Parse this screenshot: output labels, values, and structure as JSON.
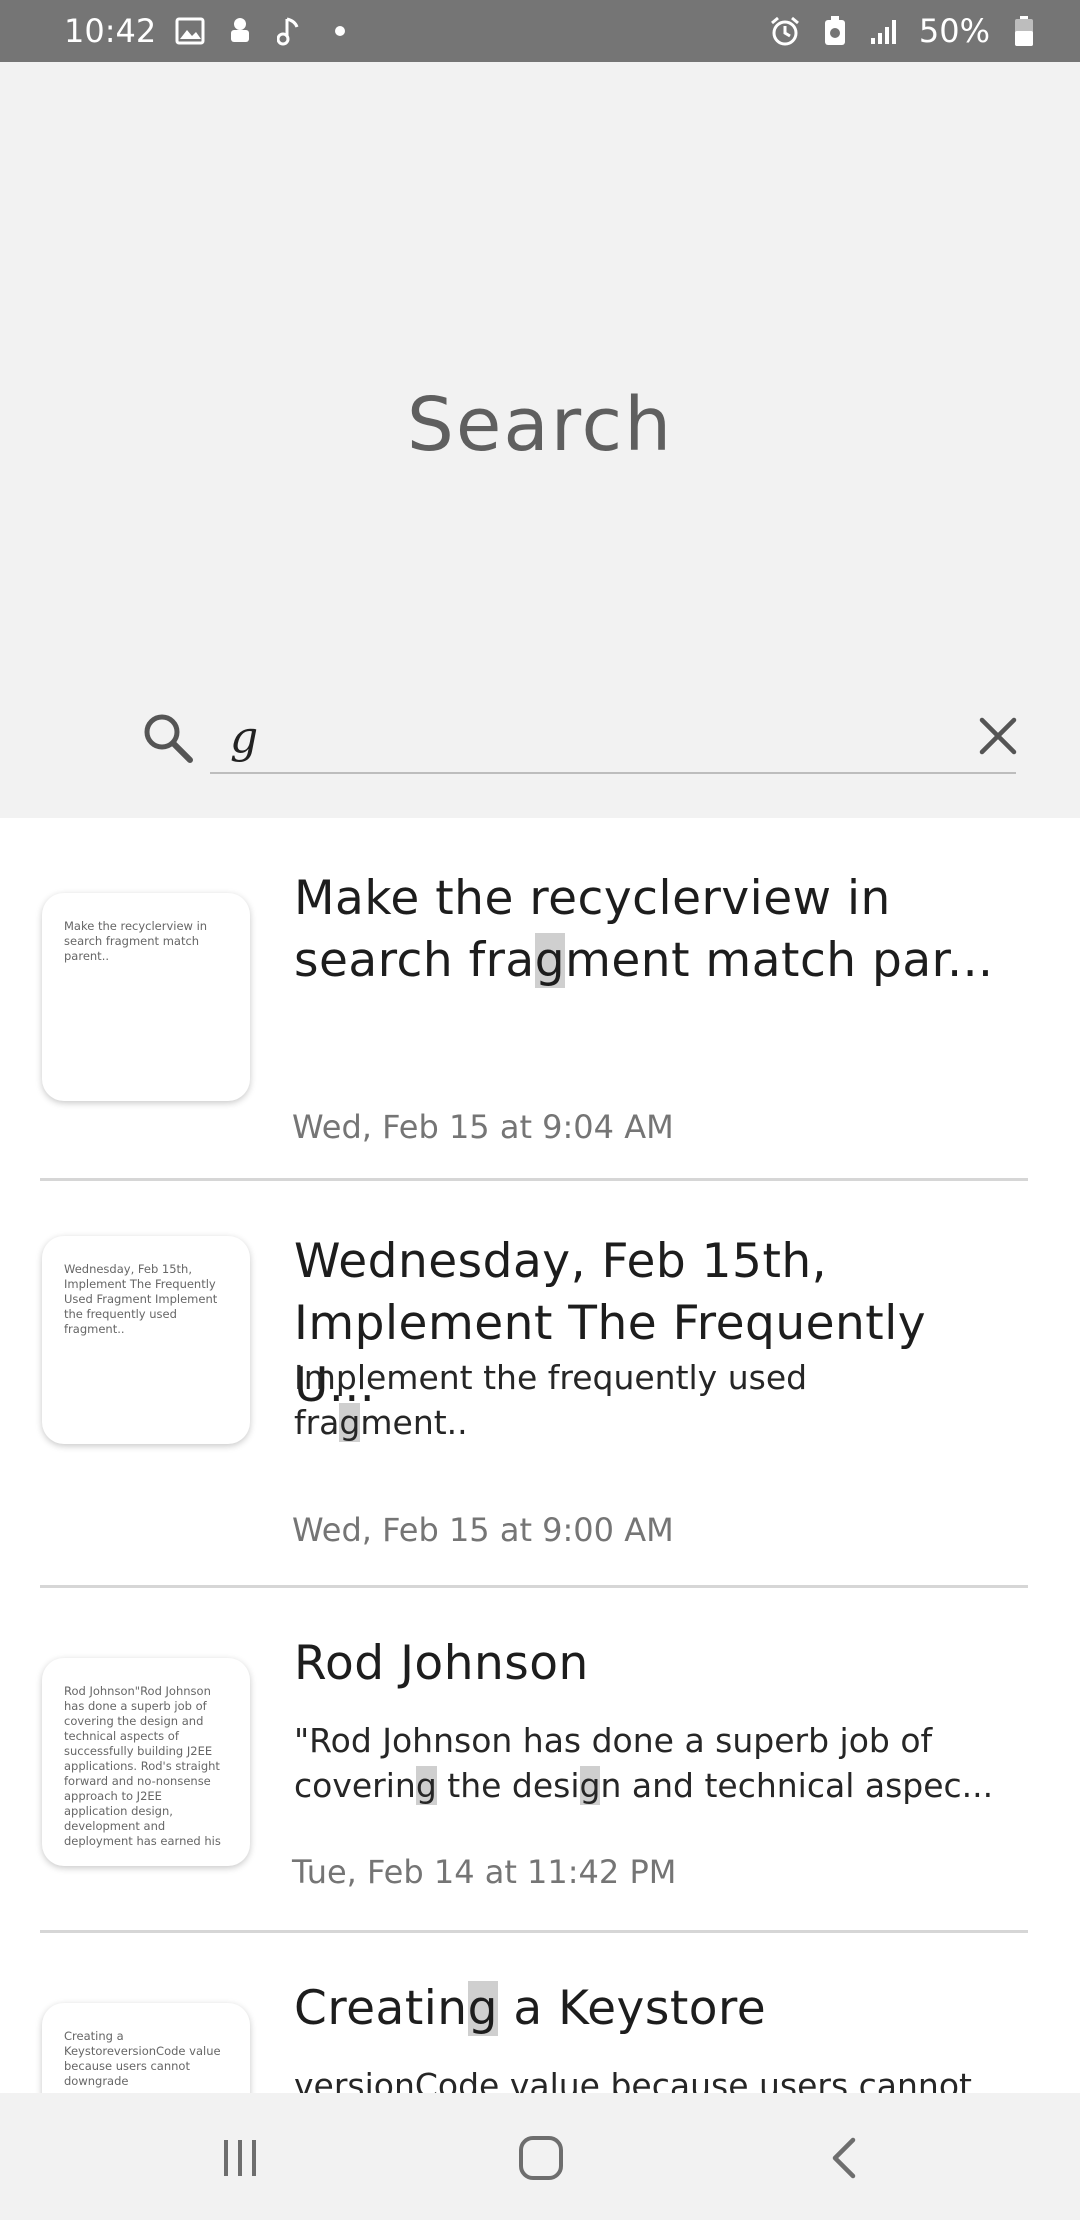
{
  "status_bar": {
    "time": "10:42",
    "battery": "50%",
    "left_icons": [
      "image-icon",
      "android-icon",
      "music-note-icon",
      "dot-icon"
    ],
    "right_icons": [
      "alarm-icon",
      "battery-saver-icon",
      "signal-icon",
      "battery-icon"
    ]
  },
  "header": {
    "title": "Search"
  },
  "search": {
    "query": "g",
    "icon": "search-icon",
    "clear_icon": "close-icon"
  },
  "results": [
    {
      "thumb_text": "Make the recyclerview in\nsearch fragment match\nparent..",
      "title_parts": [
        "Make the recyclerview in\nsearch fra",
        "g",
        "ment match par..."
      ],
      "snippet_parts": [],
      "date": "Wed, Feb 15 at 9:04 AM"
    },
    {
      "thumb_text": "Wednesday, Feb 15th,\nImplement The Frequently\nUsed Fragment Implement\nthe frequently used\nfragment..",
      "title_parts": [
        "Wednesday, Feb 15th,\nImplement The Frequently U..."
      ],
      "snippet_parts": [
        "Implement the frequently used\nfra",
        "g",
        "ment.."
      ],
      "date": "Wed, Feb 15 at 9:00 AM"
    },
    {
      "thumb_text": "Rod Johnson\"Rod Johnson\nhas done a superb job\nof covering the design\nand technical aspects of\nsuccessfully\nbuilding J2EE applications.\nRod's straight forward and\nno-nonsense approach to\nJ2EE application\ndesign, development and\ndeployment has earned his",
      "title_parts": [
        "Rod Johnson"
      ],
      "snippet_parts": [
        "\"Rod Johnson has done a superb job of\ncoverin",
        "g",
        " the desi",
        "g",
        "n and technical aspec..."
      ],
      "date": "Tue, Feb 14 at 11:42 PM"
    },
    {
      "thumb_text": "Creating a\nKeystoreversionCode value\nbecause users cannot\ndowngrade",
      "title_parts": [
        "Creatin",
        "g",
        " a Keystore"
      ],
      "snippet_parts": [
        "versionCode value because users cannot"
      ],
      "date": ""
    }
  ],
  "nav_bar": {
    "buttons": [
      "recent-apps-icon",
      "home-icon",
      "back-icon"
    ]
  }
}
